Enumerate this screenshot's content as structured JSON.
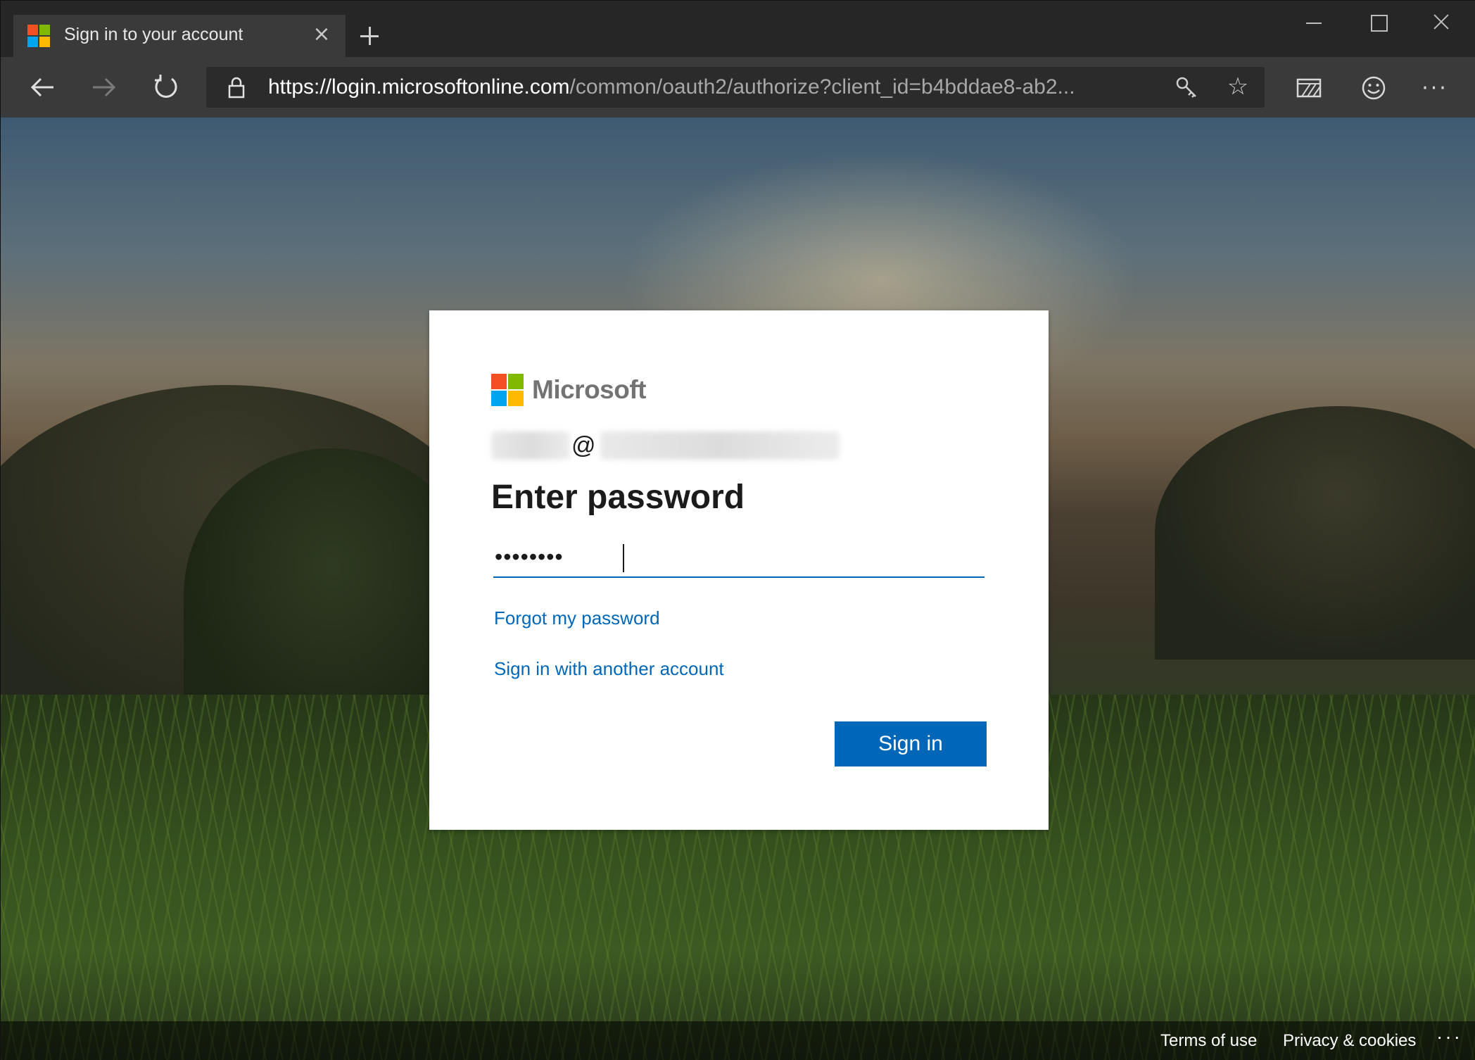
{
  "browser": {
    "tab": {
      "title": "Sign in to your account",
      "close_glyph": "×",
      "favicon": "microsoft-logo"
    },
    "new_tab_glyph": "+",
    "window_controls": [
      "minimize",
      "maximize",
      "close"
    ],
    "address_bar": {
      "scheme": "https://",
      "host": "login.microsoftonline.com",
      "path": "/common/oauth2/authorize?client_id=b4bddae8-ab2..."
    },
    "toolbar_icons": [
      "back-arrow-icon",
      "forward-arrow-icon",
      "refresh-icon",
      "lock-icon",
      "key-icon",
      "star-icon",
      "reading-view-icon",
      "feedback-smile-icon",
      "more-icon"
    ],
    "star_glyph": "☆",
    "more_glyph": "···"
  },
  "colors": {
    "ms_red": "#f25022",
    "ms_green": "#7fba00",
    "ms_blue": "#00a4ef",
    "ms_yellow": "#ffb900",
    "accent": "#0067b8"
  },
  "dialog": {
    "brand": "Microsoft",
    "identity_at": "@",
    "title": "Enter password",
    "password_mask": "••••••••",
    "forgot_link": "Forgot my password",
    "other_account_link": "Sign in with another account",
    "submit_label": "Sign in"
  },
  "footer": {
    "terms": "Terms of use",
    "privacy": "Privacy & cookies",
    "more": "···"
  }
}
